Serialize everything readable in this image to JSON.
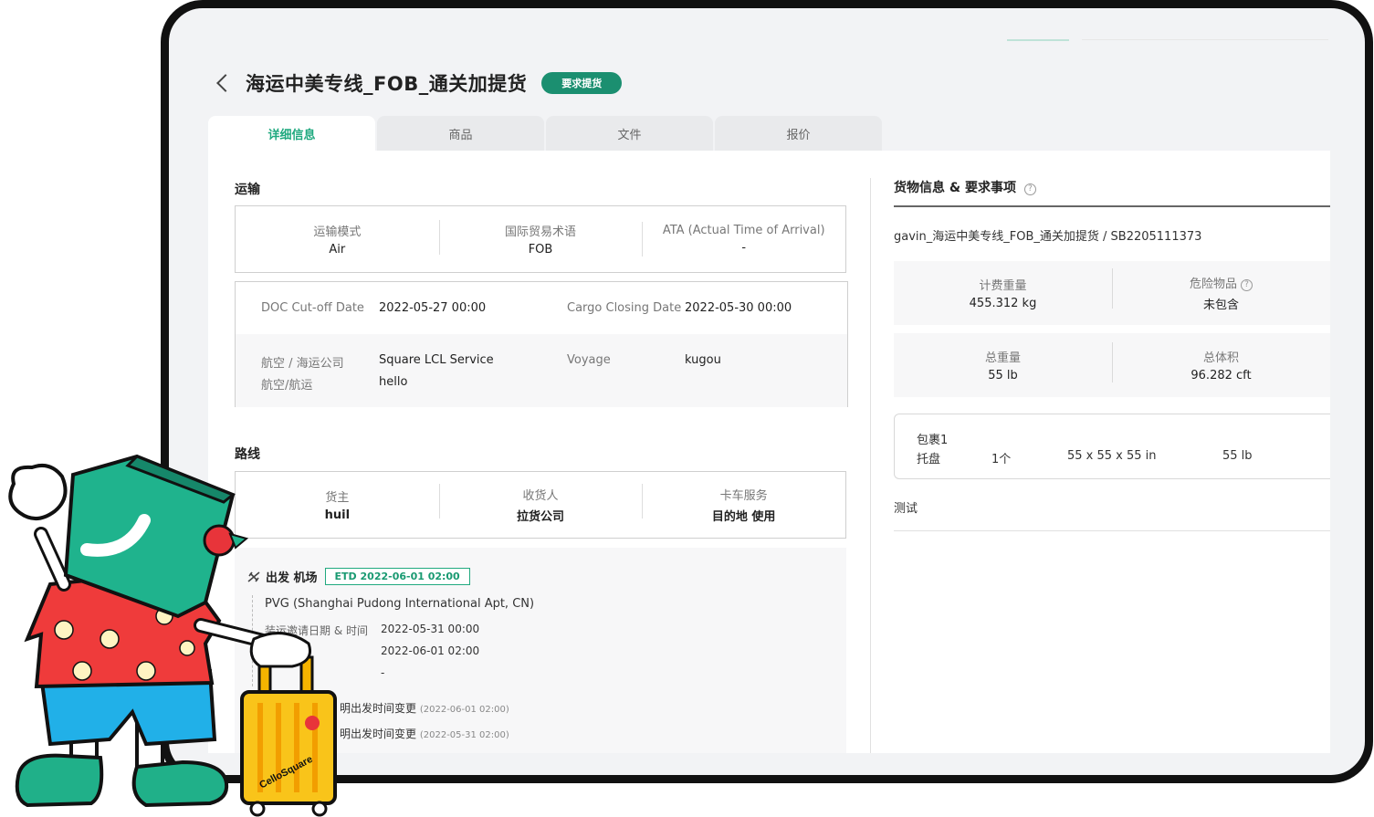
{
  "header": {
    "title": "海运中美专线_FOB_通关加提货",
    "status": "要求提货"
  },
  "tabs": [
    "详细信息",
    "商品",
    "文件",
    "报价"
  ],
  "transport": {
    "section_title": "运输",
    "summary": [
      {
        "label": "运输模式",
        "value": "Air"
      },
      {
        "label": "国际贸易术语",
        "value": "FOB"
      },
      {
        "label": "ATA (Actual Time of Arrival)",
        "value": "-"
      }
    ],
    "doc_cutoff_label": "DOC Cut-off Date",
    "doc_cutoff_value": "2022-05-27 00:00",
    "cargo_closing_label": "Cargo Closing Date",
    "cargo_closing_value": "2022-05-30 00:00",
    "carrier_label": "航空 / 海运公司",
    "carrier_value": "Square LCL Service",
    "voyage_label": "Voyage",
    "voyage_value": "kugou",
    "flight_label": "航空/航运",
    "flight_value": "hello"
  },
  "route": {
    "section_title": "路线",
    "parties": [
      {
        "label": "货主",
        "value": "huil"
      },
      {
        "label": "收货人",
        "value": "拉货公司"
      },
      {
        "label": "卡车服务",
        "value": "目的地 使用"
      }
    ],
    "departure_label": "出发 机场",
    "etd": "ETD 2022-06-01 02:00",
    "airport": "PVG (Shanghai Pudong International Apt, CN)",
    "invite_label": "装运邀请日期 & 时间",
    "invite_value": "2022-05-31 00:00",
    "second_time": "2022-06-01 02:00",
    "dash": "-",
    "change1_text": "明出发时间变更",
    "change1_date": "(2022-06-01 02:00)",
    "change2_text": "明出发时间变更",
    "change2_date": "(2022-05-31 02:00)"
  },
  "cargo": {
    "section_title": "货物信息 & 要求事项",
    "help": "?",
    "reference": "gavin_海运中美专线_FOB_通关加提货 / SB2205111373",
    "chargeable_label": "计费重量",
    "chargeable_value": "455.312 kg",
    "dangerous_label": "危险物品",
    "dangerous_value": "未包含",
    "gross_label": "总重量",
    "gross_value": "55 lb",
    "volume_label": "总体积",
    "volume_value": "96.282 cft",
    "package_name": "包裹1",
    "package_type": "托盘",
    "package_qty": "1个",
    "package_dims": "55 x 55 x 55 in",
    "package_weight": "55 lb",
    "note": "测试"
  },
  "mascot": {
    "luggage_brand": "CelloSquare"
  },
  "colors": {
    "accent": "#1fa97f",
    "badge": "#1b8f70",
    "frame": "#111111"
  }
}
